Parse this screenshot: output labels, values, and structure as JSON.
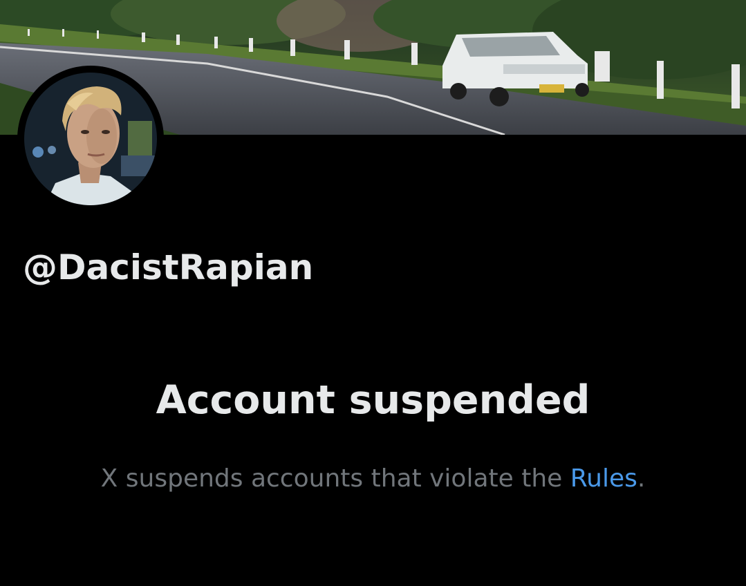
{
  "profile": {
    "handle": "@DacistRapian",
    "banner_icon": "banner-image",
    "avatar_icon": "profile-photo"
  },
  "suspension": {
    "title": "Account suspended",
    "message_prefix": "X suspends accounts that violate the ",
    "rules_link": "Rules",
    "message_suffix": "."
  },
  "colors": {
    "background": "#000000",
    "primary_text": "#e7e9ea",
    "secondary_text": "#71767b",
    "link": "#4a99e9"
  }
}
